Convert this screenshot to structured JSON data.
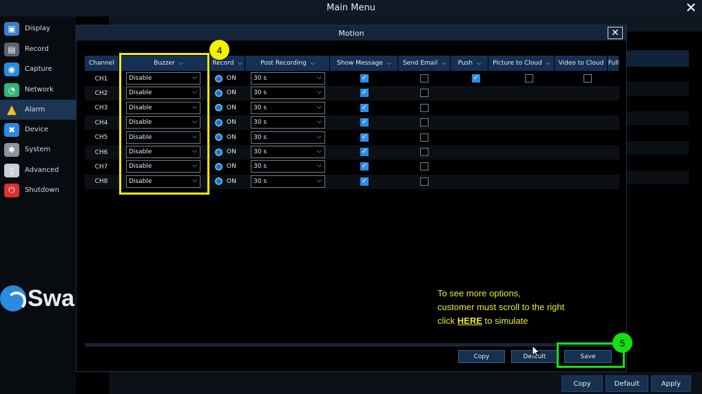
{
  "window": {
    "title": "Main Menu"
  },
  "sidebar": {
    "items": [
      {
        "label": "Display",
        "icon": "display-icon",
        "color": "#3a7fc8"
      },
      {
        "label": "Record",
        "icon": "record-icon",
        "color": "#5a6470"
      },
      {
        "label": "Capture",
        "icon": "camera-icon",
        "color": "#2a8ae0"
      },
      {
        "label": "Network",
        "icon": "network-icon",
        "color": "#2fb37a"
      },
      {
        "label": "Alarm",
        "icon": "alarm-icon",
        "color": "#f0c020"
      },
      {
        "label": "Device",
        "icon": "device-icon",
        "color": "#2a8ae0"
      },
      {
        "label": "System",
        "icon": "gear-icon",
        "color": "#8a939e"
      },
      {
        "label": "Advanced",
        "icon": "mouse-icon",
        "color": "#c8ced6"
      },
      {
        "label": "Shutdown",
        "icon": "power-icon",
        "color": "#e03030"
      }
    ],
    "active_index": 4,
    "brand": "Swa"
  },
  "dialog": {
    "title": "Motion",
    "columns": [
      {
        "label": "Channel",
        "chevron": false
      },
      {
        "label": "Buzzer",
        "chevron": true
      },
      {
        "label": "Record",
        "chevron": true
      },
      {
        "label": "Post Recording",
        "chevron": true
      },
      {
        "label": "Show Message",
        "chevron": true
      },
      {
        "label": "Send Email",
        "chevron": true
      },
      {
        "label": "Push",
        "chevron": true
      },
      {
        "label": "Picture to Cloud",
        "chevron": true
      },
      {
        "label": "Video to Cloud",
        "chevron": false
      },
      {
        "label": "Full",
        "chevron": false
      }
    ],
    "rows": [
      {
        "channel": "CH1",
        "buzzer": "Disable",
        "record": "ON",
        "post_recording": "30 s",
        "show_message": true,
        "send_email": false,
        "push": true,
        "picture_to_cloud": false,
        "video_to_cloud": false
      },
      {
        "channel": "CH2",
        "buzzer": "Disable",
        "record": "ON",
        "post_recording": "30 s",
        "show_message": true,
        "send_email": false
      },
      {
        "channel": "CH3",
        "buzzer": "Disable",
        "record": "ON",
        "post_recording": "30 s",
        "show_message": true,
        "send_email": false
      },
      {
        "channel": "CH4",
        "buzzer": "Disable",
        "record": "ON",
        "post_recording": "30 s",
        "show_message": true,
        "send_email": false
      },
      {
        "channel": "CH5",
        "buzzer": "Disable",
        "record": "ON",
        "post_recording": "30 s",
        "show_message": true,
        "send_email": false
      },
      {
        "channel": "CH6",
        "buzzer": "Disable",
        "record": "ON",
        "post_recording": "30 s",
        "show_message": true,
        "send_email": false
      },
      {
        "channel": "CH7",
        "buzzer": "Disable",
        "record": "ON",
        "post_recording": "30 s",
        "show_message": true,
        "send_email": false
      },
      {
        "channel": "CH8",
        "buzzer": "Disable",
        "record": "ON",
        "post_recording": "30 s",
        "show_message": true,
        "send_email": false
      }
    ],
    "buttons": {
      "copy": "Copy",
      "default": "Default",
      "save": "Save"
    }
  },
  "annotations": {
    "step4": "4",
    "step5": "5",
    "hint_line1": "To see more options,",
    "hint_line2": "customer must scroll to the right",
    "hint_click": "click",
    "hint_here": "HERE",
    "hint_tail": "to simulate",
    "highlight_yellow": "#f5f000",
    "highlight_green": "#14e014"
  },
  "footer": {
    "copy": "Copy",
    "default": "Default",
    "apply": "Apply"
  },
  "colors": {
    "header_bg": "#153055",
    "checkbox_on": "#2e8ee6",
    "button_bg": "#16304f"
  }
}
